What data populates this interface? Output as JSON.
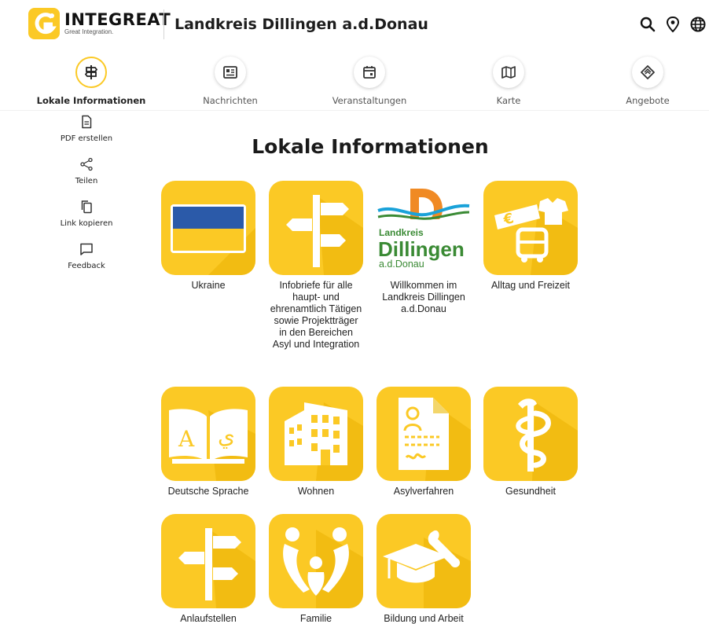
{
  "header": {
    "logo_name": "INTEGREAT",
    "logo_tagline": "Great Integration.",
    "region": "Landkreis Dillingen a.d.Donau",
    "icons": [
      "search-icon",
      "location-icon",
      "language-icon"
    ]
  },
  "tabs": [
    {
      "label": "Lokale Informationen",
      "icon": "signpost-icon",
      "active": true
    },
    {
      "label": "Nachrichten",
      "icon": "news-icon",
      "active": false
    },
    {
      "label": "Veranstaltungen",
      "icon": "calendar-icon",
      "active": false
    },
    {
      "label": "Karte",
      "icon": "map-icon",
      "active": false
    },
    {
      "label": "Angebote",
      "icon": "offers-icon",
      "active": false
    }
  ],
  "sidebar": {
    "items": [
      {
        "label": "PDF erstellen",
        "icon": "pdf-icon"
      },
      {
        "label": "Teilen",
        "icon": "share-icon"
      },
      {
        "label": "Link kopieren",
        "icon": "copy-link-icon"
      },
      {
        "label": "Feedback",
        "icon": "feedback-icon"
      }
    ]
  },
  "main": {
    "title": "Lokale Informationen",
    "categories": [
      {
        "label": "Ukraine",
        "icon": "ukraine-flag-icon"
      },
      {
        "label": "Infobriefe für alle haupt- und ehrenamtlich Tätigen sowie Projektträger in den Bereichen Asyl und Integration",
        "icon": "signpost-icon"
      },
      {
        "label": "Willkommen im Landkreis Dillingen a.d.Donau",
        "icon": "landkreis-logo-icon",
        "logo_text": [
          "Landkreis",
          "Dillingen",
          "a.d.Donau"
        ]
      },
      {
        "label": "Alltag und Freizeit",
        "icon": "everyday-life-icon"
      },
      {
        "label": "Deutsche Sprache",
        "icon": "book-icon"
      },
      {
        "label": "Wohnen",
        "icon": "building-icon"
      },
      {
        "label": "Asylverfahren",
        "icon": "document-icon"
      },
      {
        "label": "Gesundheit",
        "icon": "health-icon"
      },
      {
        "label": "Anlaufstellen",
        "icon": "signpost-icon"
      },
      {
        "label": "Familie",
        "icon": "family-icon"
      },
      {
        "label": "Bildung und Arbeit",
        "icon": "education-work-icon"
      }
    ]
  },
  "colors": {
    "accent": "#fbc925",
    "tile_shadow": "#e8b300",
    "text": "#222222"
  }
}
